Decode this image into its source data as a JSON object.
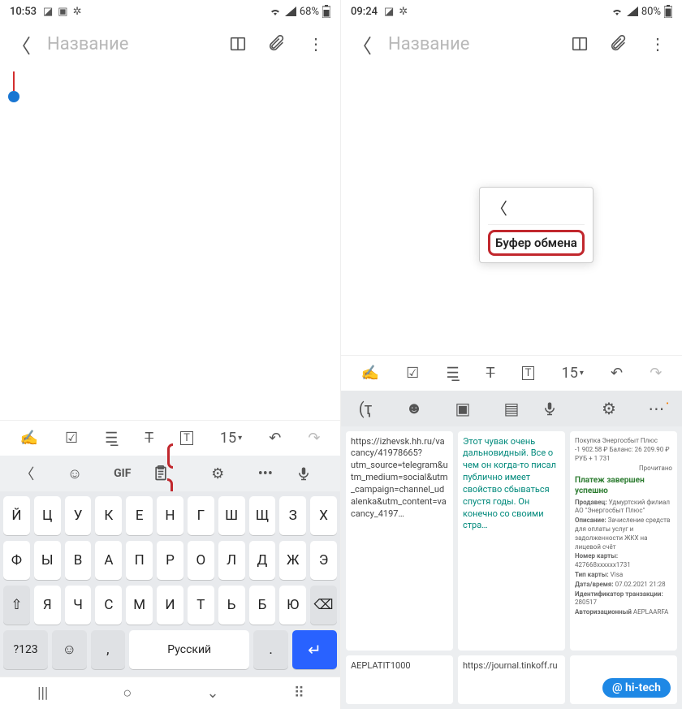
{
  "left": {
    "status": {
      "time": "10:53",
      "battery": "68%"
    },
    "app": {
      "title_placeholder": "Название"
    },
    "format_toolbar": {
      "font_size": "15"
    },
    "kb_top": {
      "gif": "GIF"
    },
    "keyboard": {
      "row1": [
        "Й",
        "Ц",
        "У",
        "К",
        "Е",
        "Н",
        "Г",
        "Ш",
        "Щ",
        "З",
        "Х"
      ],
      "row2": [
        "Ф",
        "Ы",
        "В",
        "А",
        "П",
        "Р",
        "О",
        "Л",
        "Д",
        "Ж",
        "Э"
      ],
      "row3": [
        "Я",
        "Ч",
        "С",
        "М",
        "И",
        "Т",
        "Ь",
        "Б",
        "Ю"
      ],
      "numbers": "?123",
      "language": "Русский"
    }
  },
  "right": {
    "status": {
      "time": "09:24",
      "battery": "80%"
    },
    "app": {
      "title_placeholder": "Название"
    },
    "popup": {
      "label": "Буфер обмена"
    },
    "format_toolbar": {
      "font_size": "15"
    },
    "clipboard": {
      "card1": "https://izhevsk.hh.ru/vacancy/41978665?utm_source=telegram&utm_medium=social&utm_campaign=channel_udalenka&utm_content=vacancy_4197…",
      "card2": "Этот чувак очень дальновидный. Все о чем он когда-то писал публично имеет свойство сбываться спустя годы. Он конечно со своими стра…",
      "card3": {
        "line1": "Покупка Энергосбыт Плюс",
        "line2": "-1 902.58 ₽  Баланс: 26 209.90 ₽ РУБ + 1 731",
        "line3": "Прочитано",
        "title": "Платеж завершен успешно",
        "f1": "Продавец:",
        "v1": "Удмуртский филиал АО \"Энергосбыт Плюс\"",
        "f2": "Описание:",
        "v2": "Зачисление средств для оплаты услуг и задолженности ЖКХ на лицевой счёт",
        "f3": "Номер карты:",
        "v3": "427668xxxxxx1731",
        "f4": "Тип карты:",
        "v4": "Visa",
        "f5": "Дата/время:",
        "v5": "07.02.2021 21:28",
        "f6": "Идентификатор транзакции:",
        "v6": "280517",
        "f7": "Авторизационный",
        "v7": "AEPLAARFA"
      },
      "card4": "AEPLATIT1000",
      "card5": "https://journal.tinkoff.ru"
    }
  },
  "watermark": "@ hi-tech"
}
